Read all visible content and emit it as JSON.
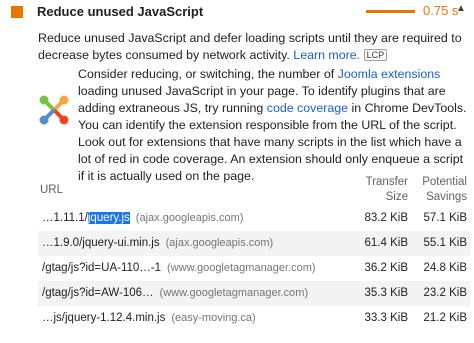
{
  "audit": {
    "title": "Reduce unused JavaScript",
    "score": "0.75 s",
    "status_color": "#e67700"
  },
  "description": {
    "text": "Reduce unused JavaScript and defer loading scripts until they are required to decrease bytes consumed by network activity.",
    "learn_more": "Learn more.",
    "badge": "LCP"
  },
  "stack_pack": {
    "icon": "joomla-icon",
    "text_1": "Consider reducing, or switching, the number of",
    "link_1": "Joomla extensions",
    "text_2": "loading unused JavaScript in your page. To identify plugins that are adding extraneous JS, try running",
    "link_2": "code coverage",
    "text_3": "in Chrome DevTools. You can identify the extension responsible from the URL of the script. Look out for extensions that have many scripts in the list which have a lot of red in code coverage. An extension should only enqueue a script if it is actually used on the page."
  },
  "table": {
    "headers": {
      "url": "URL",
      "transfer_line1": "Transfer",
      "transfer_line2": "Size",
      "savings_line1": "Potential",
      "savings_line2": "Savings"
    },
    "rows": [
      {
        "url_prefix": "…1.11.1/",
        "url_highlight": "jquery.js",
        "url_suffix": "",
        "host": "(ajax.googleapis.com)",
        "size": "83.2 KiB",
        "savings": "57.1 KiB"
      },
      {
        "url_prefix": "…1.9.0/jquery-ui.min.js",
        "url_highlight": "",
        "url_suffix": "",
        "host": "(ajax.googleapis.com)",
        "size": "61.4 KiB",
        "savings": "55.1 KiB"
      },
      {
        "url_prefix": "/gtag/js?id=UA-110…-1",
        "url_highlight": "",
        "url_suffix": "",
        "host": "(www.googletagmanager.com)",
        "size": "36.2 KiB",
        "savings": "24.8 KiB"
      },
      {
        "url_prefix": "/gtag/js?id=AW-106…",
        "url_highlight": "",
        "url_suffix": "",
        "host": "(www.googletagmanager.com)",
        "size": "35.3 KiB",
        "savings": "23.2 KiB"
      },
      {
        "url_prefix": "…js/jquery-1.12.4.min.js",
        "url_highlight": "",
        "url_suffix": "",
        "host": "(easy-moving.ca)",
        "size": "33.3 KiB",
        "savings": "21.2 KiB"
      }
    ]
  }
}
